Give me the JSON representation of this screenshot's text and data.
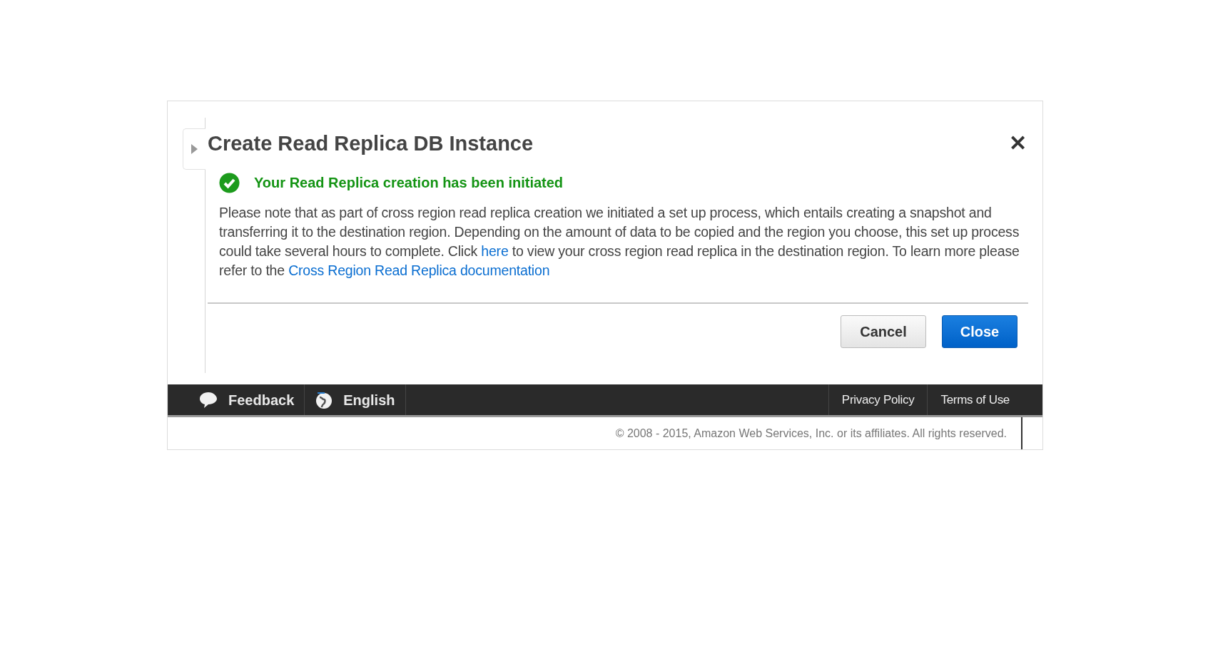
{
  "dialog": {
    "title": "Create Read Replica DB Instance",
    "close_glyph": "✕",
    "status": {
      "kind": "success",
      "text": "Your Read Replica creation has been initiated"
    },
    "message": [
      {
        "kind": "text",
        "text": "Please note that as part of cross region read replica creation we initiated a set up process, which entails creating a snapshot and transferring it to the destination region. Depending on the amount of data to be copied and the region you choose, this set up process could take several hours to complete. Click "
      },
      {
        "kind": "link",
        "text": "here"
      },
      {
        "kind": "text",
        "text": " to view your cross region read replica in the destination region. To learn more please refer to the "
      },
      {
        "kind": "link",
        "text": "Cross Region Read Replica documentation"
      }
    ],
    "buttons": [
      {
        "label": "Cancel",
        "primary": false
      },
      {
        "label": "Close",
        "primary": true
      }
    ]
  },
  "footer": {
    "left_items": [
      {
        "kind": "feedback",
        "label": "Feedback"
      },
      {
        "kind": "language",
        "label": "English"
      }
    ],
    "right_items": [
      {
        "label": "Privacy Policy"
      },
      {
        "label": "Terms of Use"
      }
    ],
    "copyright": "© 2008 - 2015, Amazon Web Services, Inc. or its affiliates. All rights reserved."
  }
}
